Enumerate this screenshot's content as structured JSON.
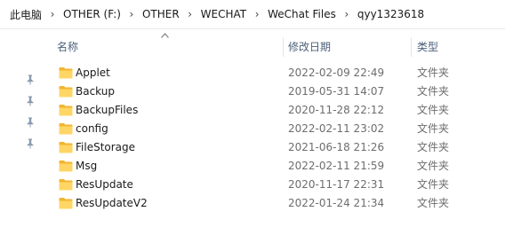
{
  "breadcrumb": [
    "此电脑",
    "OTHER (F:)",
    "OTHER",
    "WECHAT",
    "WeChat Files",
    "qyy1323618"
  ],
  "columns": {
    "name": "名称",
    "date": "修改日期",
    "type": "类型"
  },
  "sort": {
    "column": "name",
    "direction": "ascending"
  },
  "folder_color": "#ffcc4d",
  "rows": [
    {
      "name": "Applet",
      "date": "2022-02-09 22:49",
      "type": "文件夹",
      "icon": "folder-icon"
    },
    {
      "name": "Backup",
      "date": "2019-05-31 14:07",
      "type": "文件夹",
      "icon": "folder-icon"
    },
    {
      "name": "BackupFiles",
      "date": "2020-11-28 22:12",
      "type": "文件夹",
      "icon": "folder-icon"
    },
    {
      "name": "config",
      "date": "2022-02-11 23:02",
      "type": "文件夹",
      "icon": "folder-icon"
    },
    {
      "name": "FileStorage",
      "date": "2021-06-18 21:26",
      "type": "文件夹",
      "icon": "folder-icon"
    },
    {
      "name": "Msg",
      "date": "2022-02-11 21:59",
      "type": "文件夹",
      "icon": "folder-icon"
    },
    {
      "name": "ResUpdate",
      "date": "2020-11-17 22:31",
      "type": "文件夹",
      "icon": "folder-icon"
    },
    {
      "name": "ResUpdateV2",
      "date": "2022-01-24 21:34",
      "type": "文件夹",
      "icon": "folder-icon"
    }
  ],
  "quick_access_pins": [
    "pin-icon",
    "pin-icon",
    "pin-icon",
    "pin-icon"
  ]
}
